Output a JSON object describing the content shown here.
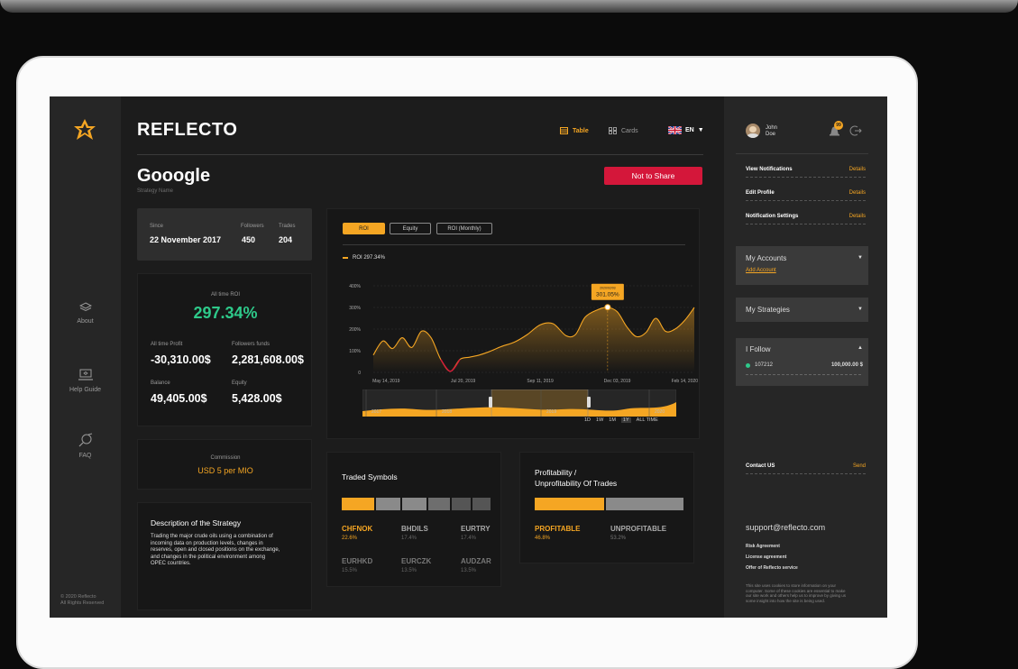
{
  "nav": {
    "about": "About",
    "help_guide": "Help Guide",
    "faq": "FAQ",
    "copyright_line1": "© 2020 Reflecto",
    "copyright_line2": "All Rights Reserved"
  },
  "header": {
    "brand": "REFLECTO",
    "view_table": "Table",
    "view_cards": "Cards",
    "language": "EN"
  },
  "strategy": {
    "name": "Gooogle",
    "name_label": "Strategy Name",
    "share_button": "Not to Share",
    "since_label": "Since",
    "since_value": "22 November 2017",
    "followers_label": "Followers",
    "followers_value": "450",
    "trades_label": "Trades",
    "trades_value": "204",
    "all_time_roi_label": "All time ROI",
    "all_time_roi_value": "297.34%",
    "profit_label": "All time Profit",
    "profit_value": "-30,310.00$",
    "funds_label": "Followers funds",
    "funds_value": "2,281,608.00$",
    "balance_label": "Balance",
    "balance_value": "49,405.00$",
    "equity_label": "Equity",
    "equity_value": "5,428.00$",
    "commission_label": "Commission",
    "commission_value": "USD 5 per MIO",
    "description_title": "Description of the Strategy",
    "description_lines": [
      "Trading the major crude oils using a combination of",
      "incoming data on production levels, changes in",
      "reserves, open and closed positions on the exchange,",
      "and changes in the political environment among",
      "OPEC countries."
    ]
  },
  "chart_tabs": [
    "ROI",
    "Equity",
    "ROI (Monthly)"
  ],
  "chart_legend": "ROI  297.34%",
  "tooltip": {
    "date": "2020/02/03",
    "value": "301.05%"
  },
  "range_buttons": [
    "1D",
    "1W",
    "1M",
    "1Y",
    "ALL TIME"
  ],
  "nav_years": [
    "2017",
    "2018",
    "2019",
    "2020"
  ],
  "chart_data": {
    "type": "line",
    "title": "",
    "ylabel": "",
    "x_tick_labels": [
      "May 14, 2019",
      "Jul 20, 2019",
      "Sep 11, 2019",
      "Dec 03, 2019",
      "Feb 14, 2020"
    ],
    "y_tick_labels": [
      "0",
      "100%",
      "200%",
      "300%",
      "400%"
    ],
    "ylim": [
      0,
      400
    ],
    "grid": true,
    "series": [
      {
        "name": "ROI",
        "x": [
          0,
          0.03,
          0.06,
          0.09,
          0.12,
          0.15,
          0.18,
          0.21,
          0.24,
          0.27,
          0.3,
          0.33,
          0.36,
          0.4,
          0.44,
          0.48,
          0.52,
          0.56,
          0.6,
          0.63,
          0.66,
          0.7,
          0.73,
          0.76,
          0.79,
          0.82,
          0.85,
          0.88,
          0.91,
          0.94,
          0.97,
          1.0
        ],
        "values": [
          80,
          145,
          110,
          160,
          115,
          190,
          160,
          60,
          5,
          60,
          70,
          80,
          95,
          120,
          140,
          175,
          220,
          225,
          170,
          175,
          255,
          290,
          300,
          280,
          210,
          165,
          185,
          250,
          190,
          200,
          240,
          300
        ]
      }
    ],
    "highlight": {
      "x": 0.73,
      "value": 301.05
    }
  },
  "traded_symbols": {
    "title": "Traded Symbols",
    "items": [
      {
        "symbol": "CHFNOK",
        "pct": "22.6%",
        "active": true
      },
      {
        "symbol": "BHDILS",
        "pct": "17.4%",
        "active": false
      },
      {
        "symbol": "EURTRY",
        "pct": "17.4%",
        "active": false
      },
      {
        "symbol": "EURHKD",
        "pct": "15.5%",
        "active": false
      },
      {
        "symbol": "EURCZK",
        "pct": "13.5%",
        "active": false
      },
      {
        "symbol": "AUDZAR",
        "pct": "13.5%",
        "active": false
      }
    ]
  },
  "profitability": {
    "title_line1": "Profitability /",
    "title_line2": "Unprofitability Of Trades",
    "profitable_label": "PROFITABLE",
    "profitable_pct": "46.8%",
    "unprofitable_label": "UNPROFITABLE",
    "unprofitable_pct": "53.2%"
  },
  "user": {
    "first_name": "John",
    "last_name": "Doe",
    "notification_count": "99"
  },
  "right_menu": {
    "view_notifications": "View Notifications",
    "edit_profile": "Edit Profile",
    "notification_settings": "Notification Settings",
    "details": "Details",
    "my_accounts": "My Accounts",
    "add_account": "Add Account",
    "my_strategies": "My Strategies",
    "i_follow": "I Follow",
    "follow_id": "107212",
    "follow_amount": "100,000.00 $",
    "contact_us": "Contact US",
    "send": "Send",
    "support_email": "support@reflecto.com",
    "risk_agreement": "Risk Agreement",
    "license_agreement": "License agreement",
    "offer": "Offer of Reflecto service",
    "cookie_text": [
      "This site uses cookies to store information on your",
      "computer. Some of these cookies are essential to make",
      "our site work and others help us to improve by giving us",
      "some insight into how the site is being used."
    ]
  },
  "colors": {
    "accent": "#f5a623",
    "positive": "#2ec98a",
    "danger": "#d4173a",
    "background": "#1c1c1c"
  }
}
